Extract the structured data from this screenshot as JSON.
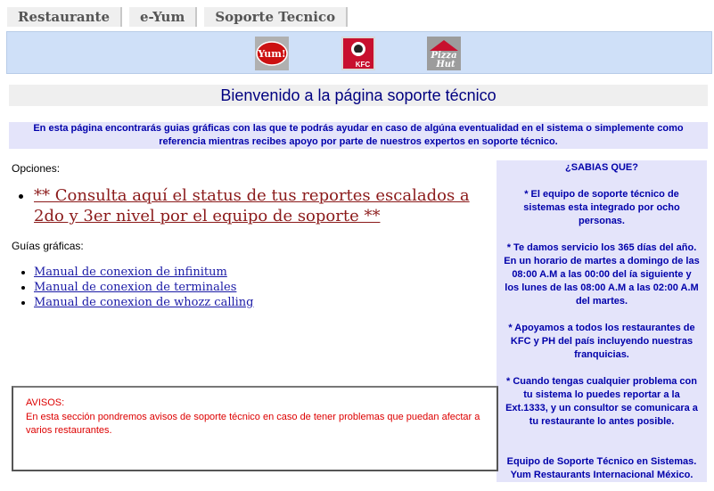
{
  "tabs": [
    {
      "label": "Restaurante"
    },
    {
      "label": "e-Yum"
    },
    {
      "label": "Soporte Tecnico"
    }
  ],
  "logos": {
    "yum": "Yum!",
    "kfc": "KFC",
    "pizza_hut_line1": "Pizza",
    "pizza_hut_line2": "Hut"
  },
  "welcome": "Bienvenido a la página soporte técnico",
  "intro": "En esta página encontrarás guias gráficas con las que te podrás ayudar en caso de algúna eventualidad en el sistema o simplemente como referencia mientras recibes apoyo por parte de nuestros expertos en soporte técnico.",
  "opciones_label": "Opciones:",
  "status_link": "** Consulta aquí el status de tus reportes escalados a 2do y 3er nivel por el equipo de soporte **",
  "guias_label": "Guías gráficas:",
  "guides": [
    {
      "label": "Manual de conexion de infinitum"
    },
    {
      "label": "Manual de conexion de terminales"
    },
    {
      "label": "Manual de conexion de whozz calling"
    }
  ],
  "sidebar": {
    "title": "¿SABIAS QUE?",
    "facts": [
      "* El equipo de soporte técnico de sistemas esta integrado por ocho personas.",
      "* Te damos servicio los 365 días del año. En un horario de martes a domingo de las 08:00 A.M a las 00:00 del ía siguiente y los lunes de las 08:00 A.M a las 02:00 A.M del martes.",
      "* Apoyamos a todos los restaurantes de KFC y PH del país incluyendo nuestras franquicias.",
      "* Cuando tengas cualquier problema con tu sistema lo puedes reportar a la Ext.1333, y un consultor se comunicara a tu restaurante lo antes posible."
    ],
    "footer": "Equipo de Soporte Técnico en Sistemas. Yum Restaurants Internacional México."
  },
  "avisos": {
    "title": "AVISOS:",
    "text": "En esta sección pondremos avisos de soporte técnico en caso de tener problemas que puedan afectar a varios restaurantes."
  },
  "colors": {
    "logo_bar": "#cfe0f8",
    "intro_bg": "#e4e4fa",
    "heading_blue": "#000080",
    "status_link": "#8b1a1a",
    "guide_link": "#1a1aa6",
    "avisos_red": "#dd0000"
  }
}
